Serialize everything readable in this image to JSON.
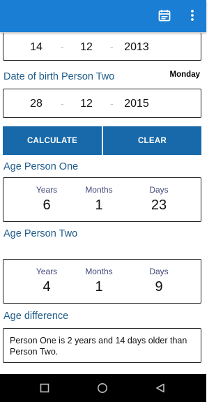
{
  "appbar": {
    "calendar_icon": "calendar-icon",
    "menu_icon": "more-vert-icon",
    "color": "#1a7fd4"
  },
  "person_one": {
    "day": "14",
    "month": "12",
    "year": "2013",
    "sep": "-"
  },
  "person_two": {
    "label": "Date of birth Person Two",
    "weekday": "Monday",
    "day": "28",
    "month": "12",
    "year": "2015",
    "sep": "-"
  },
  "buttons": {
    "calculate": "CALCULATE",
    "clear": "CLEAR"
  },
  "age_one": {
    "label": "Age Person One",
    "years_label": "Years",
    "months_label": "Months",
    "days_label": "Days",
    "years": "6",
    "months": "1",
    "days": "23"
  },
  "age_two": {
    "label": "Age Person Two",
    "years_label": "Years",
    "months_label": "Months",
    "days_label": "Days",
    "years": "4",
    "months": "1",
    "days": "9"
  },
  "difference": {
    "label": "Age difference",
    "text": "Person One is 2 years and  14 days older than Person Two."
  },
  "navbar": {
    "back_icon": "back-icon",
    "home_icon": "home-icon",
    "recents_icon": "recents-icon"
  }
}
